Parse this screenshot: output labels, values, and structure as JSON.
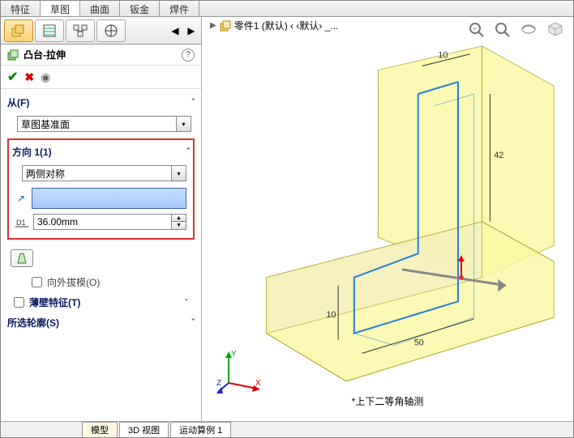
{
  "top_tabs": [
    "特征",
    "草图",
    "曲面",
    "钣金",
    "焊件"
  ],
  "active_top_tab": "草图",
  "feature": {
    "name": "凸台-拉伸",
    "help_tip": "?"
  },
  "from_section": {
    "label": "从(F)",
    "value": "草图基准面"
  },
  "direction": {
    "label": "方向 1(1)",
    "end_condition": "两侧对称",
    "depth": "36.00mm",
    "draft_label": "向外拔模(O)"
  },
  "thin_feature_label": "薄壁特征(T)",
  "contour_label": "所选轮廓(S)",
  "breadcrumb": {
    "part_label": "零件1 (默认) ‹ ‹默认› _..."
  },
  "view_mode": "*上下二等角轴测",
  "bottom_tabs": [
    "模型",
    "3D 视图",
    "运动算例 1"
  ],
  "active_bottom_tab": "模型",
  "triad_axes": [
    "X",
    "Y",
    "Z"
  ]
}
